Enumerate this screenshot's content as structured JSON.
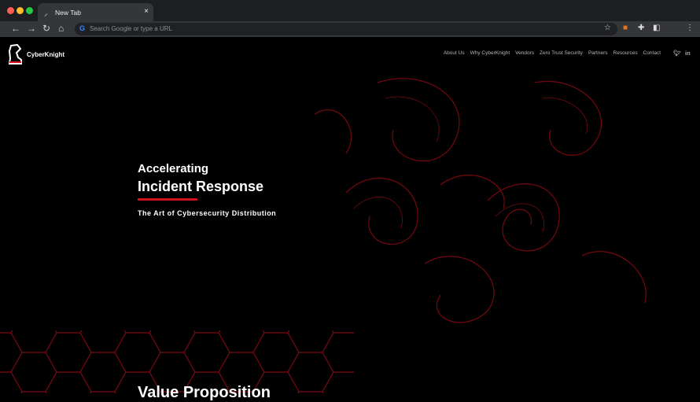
{
  "browser": {
    "tab_title": "New Tab",
    "omnibox_placeholder": "Search Google or type a URL"
  },
  "site": {
    "brand": "CyberKnight",
    "nav": [
      "About Us",
      "Why CyberKnight",
      "Vendors",
      "Zero Trust Security",
      "Partners",
      "Resources",
      "Contact"
    ],
    "social": [
      "twitter-icon",
      "linkedin-icon"
    ]
  },
  "hero": {
    "line1": "Accelerating",
    "line2": "Incident Response",
    "subtitle": "The Art of Cybersecurity Distribution"
  },
  "next_section": {
    "title": "Value Proposition"
  },
  "colors": {
    "accent": "#d0101b",
    "background": "#000000"
  }
}
